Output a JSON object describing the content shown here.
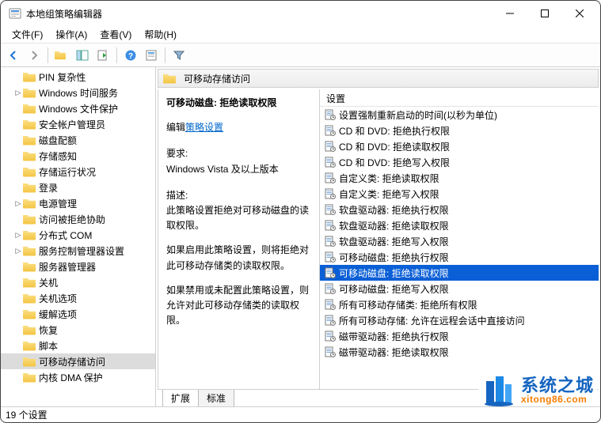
{
  "window": {
    "title": "本地组策略编辑器"
  },
  "menu": {
    "file": "文件(F)",
    "action": "操作(A)",
    "view": "查看(V)",
    "help": "帮助(H)"
  },
  "tree": {
    "items": [
      {
        "label": "PIN 复杂性",
        "level": 1
      },
      {
        "label": "Windows 时间服务",
        "level": 1,
        "exp": "▷"
      },
      {
        "label": "Windows 文件保护",
        "level": 1
      },
      {
        "label": "安全帐户管理员",
        "level": 1
      },
      {
        "label": "磁盘配额",
        "level": 1
      },
      {
        "label": "存储感知",
        "level": 1
      },
      {
        "label": "存储运行状况",
        "level": 1
      },
      {
        "label": "登录",
        "level": 1
      },
      {
        "label": "电源管理",
        "level": 1,
        "exp": "▷"
      },
      {
        "label": "访问被拒绝协助",
        "level": 1
      },
      {
        "label": "分布式 COM",
        "level": 1,
        "exp": "▷"
      },
      {
        "label": "服务控制管理器设置",
        "level": 1,
        "exp": "▷"
      },
      {
        "label": "服务器管理器",
        "level": 1
      },
      {
        "label": "关机",
        "level": 1
      },
      {
        "label": "关机选项",
        "level": 1
      },
      {
        "label": "缓解选项",
        "level": 1
      },
      {
        "label": "恢复",
        "level": 1
      },
      {
        "label": "脚本",
        "level": 1
      },
      {
        "label": "可移动存储访问",
        "level": 1,
        "selected": true
      },
      {
        "label": "内核 DMA 保护",
        "level": 1
      }
    ]
  },
  "pane": {
    "header": "可移动存储访问",
    "title": "可移动磁盘: 拒绝读取权限",
    "edit_prefix": "编辑",
    "edit_link": "策略设置",
    "reqlabel": "要求:",
    "reqtext": "Windows Vista 及以上版本",
    "desclabel": "描述:",
    "desc1": "此策略设置拒绝对可移动磁盘的读取权限。",
    "desc2": "如果启用此策略设置，则将拒绝对此可移动存储类的读取权限。",
    "desc3": "如果禁用或未配置此策略设置，则允许对此可移动存储类的读取权限。"
  },
  "list": {
    "header": "设置",
    "items": [
      "设置强制重新启动的时间(以秒为单位)",
      "CD 和 DVD: 拒绝执行权限",
      "CD 和 DVD: 拒绝读取权限",
      "CD 和 DVD: 拒绝写入权限",
      "自定义类: 拒绝读取权限",
      "自定义类: 拒绝写入权限",
      "软盘驱动器: 拒绝执行权限",
      "软盘驱动器: 拒绝读取权限",
      "软盘驱动器: 拒绝写入权限",
      "可移动磁盘: 拒绝执行权限",
      "可移动磁盘: 拒绝读取权限",
      "可移动磁盘: 拒绝写入权限",
      "所有可移动存储类: 拒绝所有权限",
      "所有可移动存储: 允许在远程会话中直接访问",
      "磁带驱动器: 拒绝执行权限",
      "磁带驱动器: 拒绝读取权限"
    ],
    "selected_index": 10
  },
  "tabs": {
    "extended": "扩展",
    "standard": "标准"
  },
  "status": "19 个设置",
  "watermark": {
    "line1": "系统之城",
    "line2": "xitong86.com"
  }
}
